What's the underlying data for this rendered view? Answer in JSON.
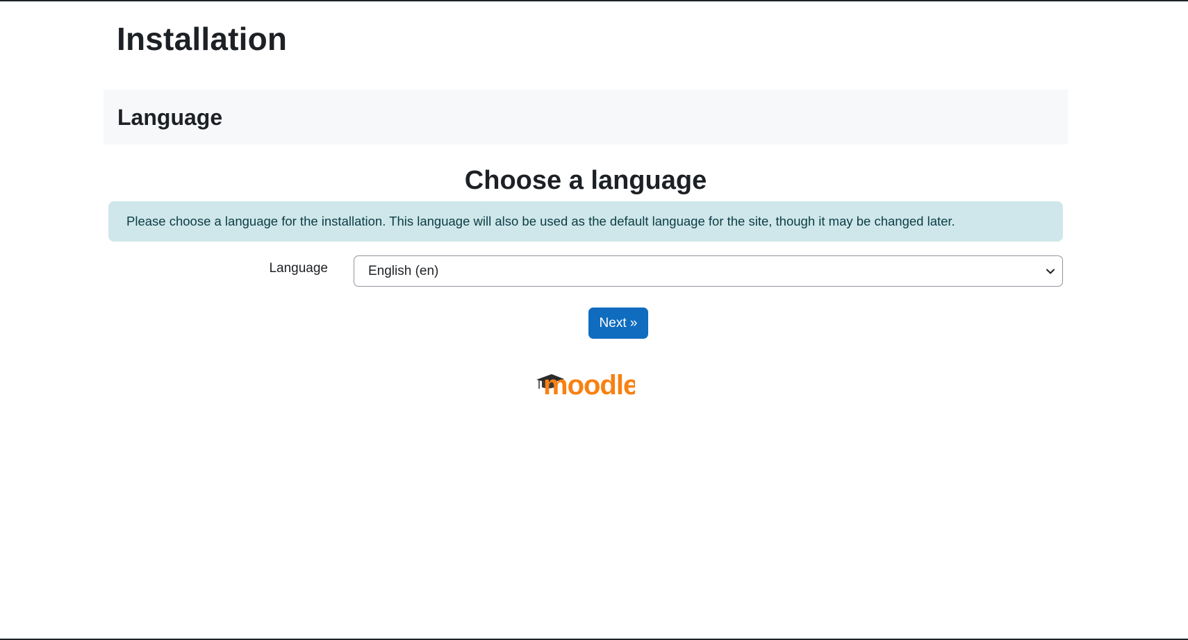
{
  "page": {
    "title": "Installation"
  },
  "section": {
    "title": "Language"
  },
  "form": {
    "heading": "Choose a language",
    "info": "Please choose a language for the installation. This language will also be used as the default language for the site, though it may be changed later.",
    "language_label": "Language",
    "language_selected": "English (en)",
    "next_label": "Next »"
  },
  "logo": {
    "text": "moodle",
    "brand_color": "#f98012"
  },
  "colors": {
    "primary": "#0f6cbf",
    "info_bg": "#cfe7ea",
    "section_bg": "#f7f8fa"
  }
}
